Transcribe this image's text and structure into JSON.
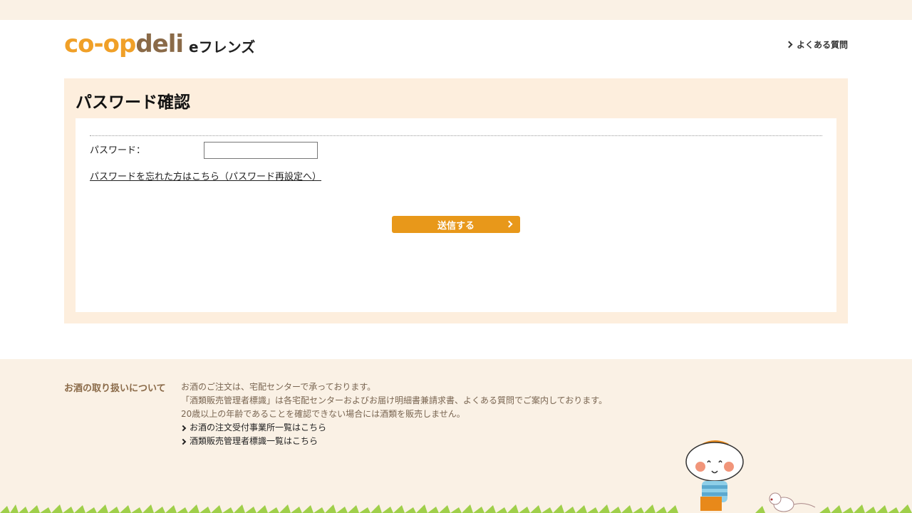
{
  "header": {
    "logo_main_a": "co-op",
    "logo_main_b": "deli",
    "logo_sub": "eフレンズ",
    "faq_label": "よくある質問"
  },
  "panel": {
    "title": "パスワード確認",
    "password_label": "パスワード：",
    "password_value": "",
    "password_placeholder": "",
    "forgot_link": "パスワードを忘れた方はこちら（パスワード再設定へ）",
    "submit_label": "送信する"
  },
  "footer": {
    "heading": "お酒の取り扱いについて",
    "lines": [
      "お酒のご注文は、宅配センターで承っております。",
      "「酒類販売管理者標識」は各宅配センターおよびお届け明細書兼請求書、よくある質問でご案内しております。",
      "20歳以上の年齢であることを確認できない場合には酒類を販売しません。"
    ],
    "links": [
      "お酒の注文受付事業所一覧はこちら",
      "酒類販売管理者標識一覧はこちら"
    ]
  },
  "colors": {
    "accent": "#e8981a",
    "logo_orange": "#f0a028",
    "logo_brown": "#8a6a48",
    "panel_bg": "#fdeedd",
    "page_bg": "#faf1e5"
  },
  "icons": {
    "faq": "chevron-right-icon",
    "submit": "chevron-right-icon",
    "footer_links": "chevron-right-icon"
  }
}
